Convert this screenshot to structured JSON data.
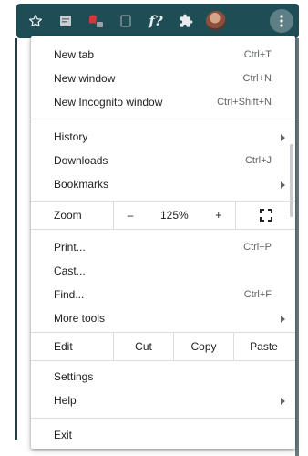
{
  "menu": {
    "new_tab": {
      "label": "New tab",
      "shortcut": "Ctrl+T"
    },
    "new_window": {
      "label": "New window",
      "shortcut": "Ctrl+N"
    },
    "new_incognito": {
      "label": "New Incognito window",
      "shortcut": "Ctrl+Shift+N"
    },
    "history": {
      "label": "History"
    },
    "downloads": {
      "label": "Downloads",
      "shortcut": "Ctrl+J"
    },
    "bookmarks": {
      "label": "Bookmarks"
    },
    "zoom": {
      "label": "Zoom",
      "minus": "–",
      "level": "125%",
      "plus": "+"
    },
    "print": {
      "label": "Print...",
      "shortcut": "Ctrl+P"
    },
    "cast": {
      "label": "Cast..."
    },
    "find": {
      "label": "Find...",
      "shortcut": "Ctrl+F"
    },
    "more_tools": {
      "label": "More tools"
    },
    "edit": {
      "label": "Edit",
      "cut": "Cut",
      "copy": "Copy",
      "paste": "Paste"
    },
    "settings": {
      "label": "Settings"
    },
    "help": {
      "label": "Help"
    },
    "exit": {
      "label": "Exit"
    }
  },
  "toolbar": {
    "extension_text": "f?"
  },
  "icons": {
    "bookmark_star": "star-icon",
    "extension_1": "notepad-icon",
    "extension_2": "reader-icon",
    "extension_3": "square-icon",
    "extension_4": "f-icon",
    "extensions": "puzzle-icon",
    "profile": "avatar",
    "menu": "kebab-icon",
    "fullscreen": "fullscreen-icon"
  },
  "colors": {
    "toolbar": "#1e4d56",
    "separator": "#dadce0",
    "text": "#202124",
    "secondary_text": "#5f6368"
  }
}
